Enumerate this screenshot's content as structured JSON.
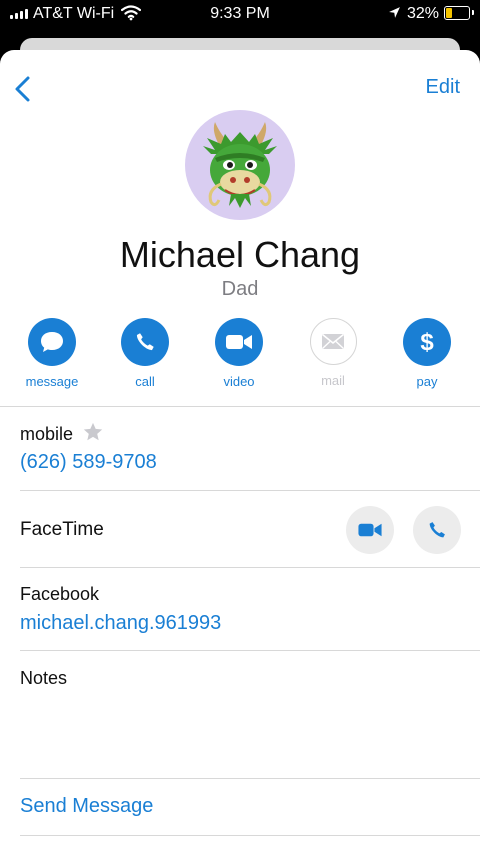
{
  "status_bar": {
    "carrier": "AT&T Wi-Fi",
    "time": "9:33 PM",
    "battery_percent": "32%",
    "battery_level": 0.32
  },
  "nav": {
    "back_icon": "chevron-left-icon",
    "edit_label": "Edit"
  },
  "contact": {
    "avatar_icon": "dragon-emoji-avatar",
    "name": "Michael Chang",
    "relation": "Dad"
  },
  "actions": [
    {
      "label": "message",
      "icon": "message-bubble-icon",
      "enabled": true
    },
    {
      "label": "call",
      "icon": "phone-icon",
      "enabled": true
    },
    {
      "label": "video",
      "icon": "video-camera-icon",
      "enabled": true
    },
    {
      "label": "mail",
      "icon": "envelope-icon",
      "enabled": false
    },
    {
      "label": "pay",
      "icon": "dollar-icon",
      "enabled": true
    }
  ],
  "mobile": {
    "label": "mobile",
    "favorite_icon": "star-icon",
    "number": "(626) 589-9708"
  },
  "facetime": {
    "label": "FaceTime",
    "video_icon": "video-camera-icon",
    "audio_icon": "phone-icon"
  },
  "facebook": {
    "label": "Facebook",
    "value": "michael.chang.961993"
  },
  "notes": {
    "label": "Notes",
    "value": ""
  },
  "send_message": {
    "label": "Send Message"
  },
  "colors": {
    "accent": "#1a7fd4",
    "avatar_bg": "#d9cdf1",
    "secondary_text": "#7d7d82",
    "disabled": "#c7c7cc"
  }
}
